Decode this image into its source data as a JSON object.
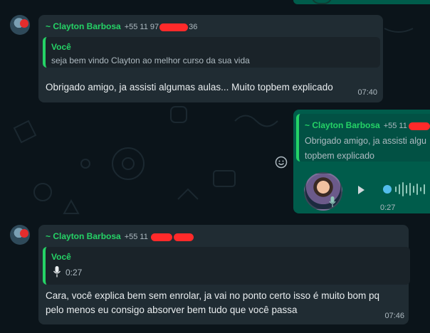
{
  "top_partial": {
    "time": ""
  },
  "msg1": {
    "sender_name": "~ Clayton Barbosa",
    "sender_phone_prefix": "+55 11 97",
    "sender_phone_suffix": "36",
    "quote_name": "Você",
    "quote_text": "seja bem vindo Clayton ao melhor curso da sua vida",
    "text": "Obrigado amigo, ja assisti algumas aulas... Muito topbem explicado",
    "time": "07:40"
  },
  "msg2": {
    "sender_name": "~ Clayton Barbosa",
    "sender_phone_prefix": "+55 11",
    "quote_line1": "Obrigado amigo, ja assisti algu",
    "quote_line2": "topbem explicado",
    "audio_duration": "0:27",
    "react_icon": "emoji-icon"
  },
  "msg3": {
    "sender_name": "~ Clayton Barbosa",
    "sender_phone_prefix": "+55 11",
    "quote_name": "Você",
    "quote_audio_duration": "0:27",
    "text_line1": "Cara, você explica bem sem enrolar, ja vai no ponto certo isso é muito bom pq",
    "text_line2": "pelo menos eu consigo absorver bem tudo que você passa",
    "time": "07:46"
  },
  "colors": {
    "background": "#0b141a",
    "incoming_bubble": "#202c33",
    "outgoing_bubble": "#005c4b",
    "sender_green": "#25d366",
    "redaction_red": "#ff2a2a",
    "audio_knob": "#53bdeb"
  }
}
